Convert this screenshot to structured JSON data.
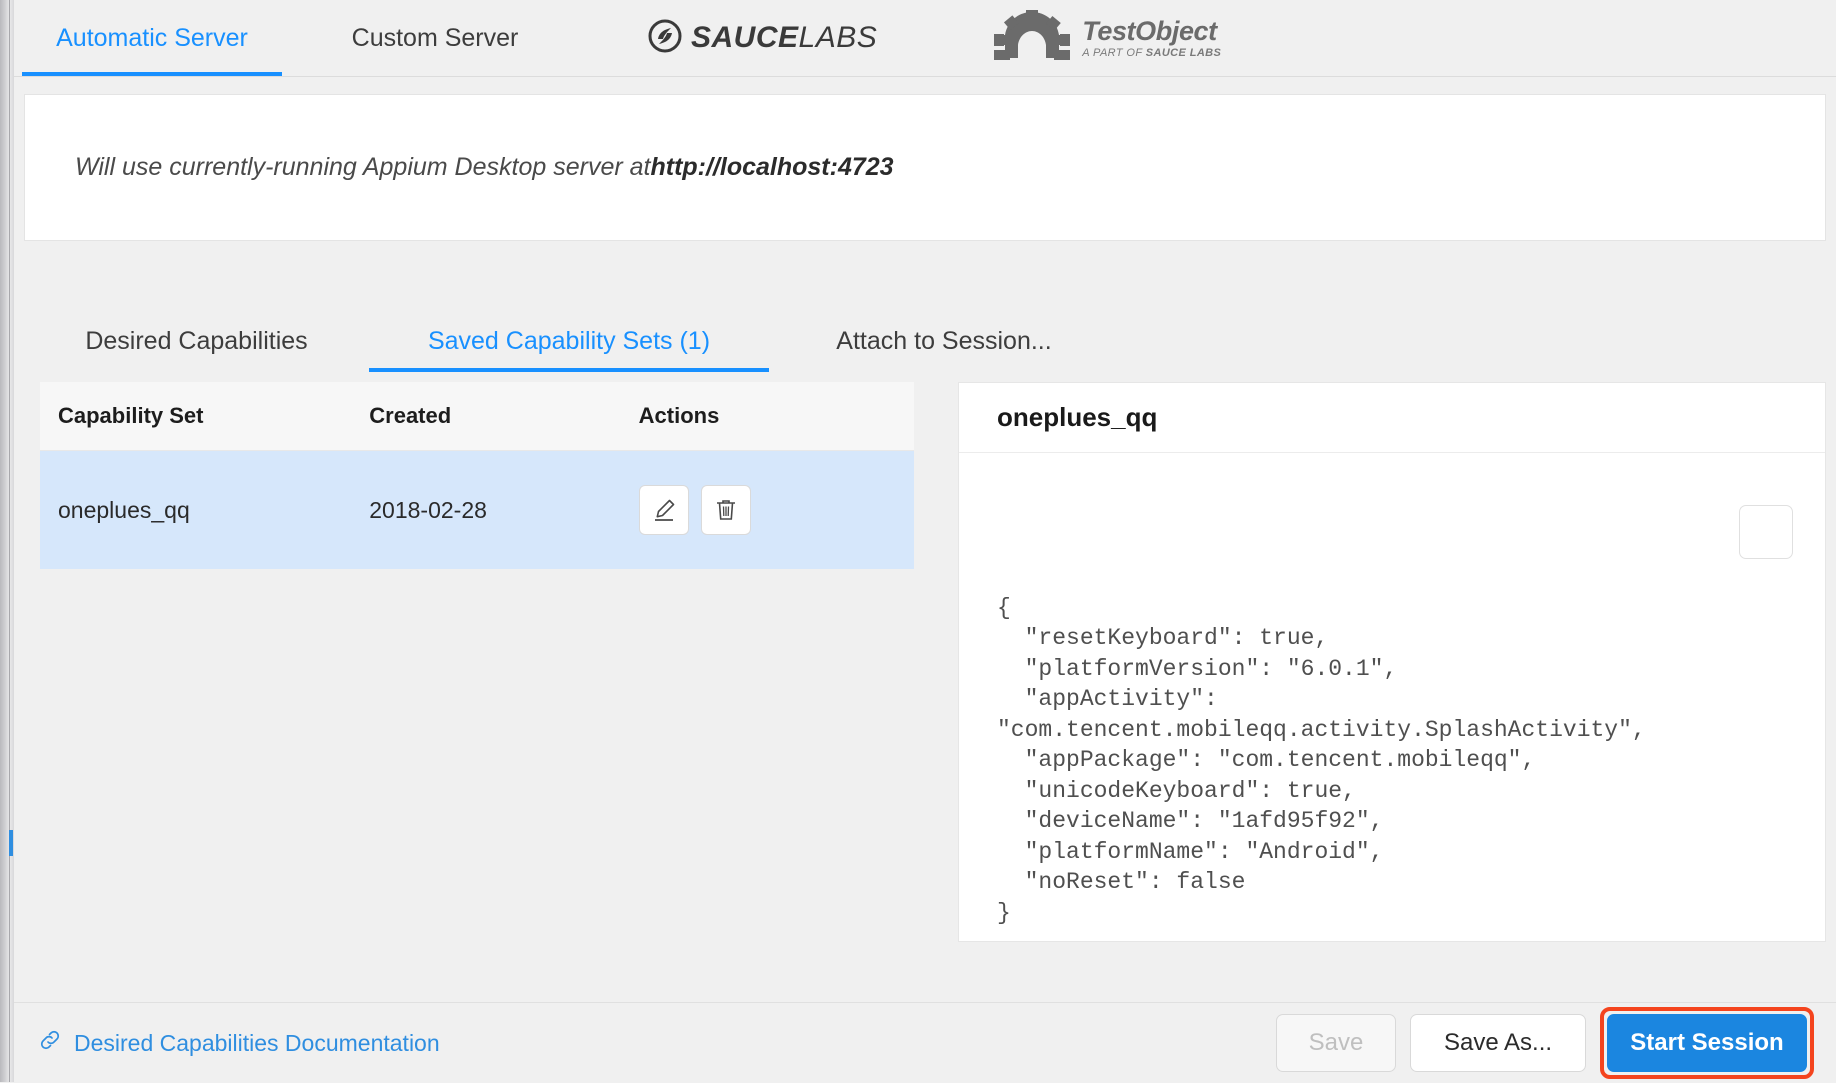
{
  "server_tabs": [
    {
      "id": "automatic",
      "label": "Automatic Server",
      "active": true
    },
    {
      "id": "custom",
      "label": "Custom Server",
      "active": false
    }
  ],
  "brand": {
    "saucelabs_bold": "SAUCE",
    "saucelabs_light": "LABS",
    "testobject_main": "TestObject",
    "testobject_sub_pre": "A PART OF ",
    "testobject_sub_bold": "SAUCE LABS"
  },
  "server_info": {
    "text_prefix": "Will use currently-running Appium Desktop server at ",
    "url": "http://localhost:4723"
  },
  "cap_tabs": [
    {
      "id": "desired",
      "label": "Desired Capabilities",
      "active": false
    },
    {
      "id": "saved",
      "label": "Saved Capability Sets (1)",
      "active": true
    },
    {
      "id": "attach",
      "label": "Attach to Session...",
      "active": false
    }
  ],
  "table": {
    "columns": [
      "Capability Set",
      "Created",
      "Actions"
    ],
    "rows": [
      {
        "name": "oneplues_qq",
        "created": "2018-02-28"
      }
    ]
  },
  "detail": {
    "title": "oneplues_qq",
    "json_text": "{\n  \"resetKeyboard\": true,\n  \"platformVersion\": \"6.0.1\",\n  \"appActivity\":\n\"com.tencent.mobileqq.activity.SplashActivity\",\n  \"appPackage\": \"com.tencent.mobileqq\",\n  \"unicodeKeyboard\": true,\n  \"deviceName\": \"1afd95f92\",\n  \"platformName\": \"Android\",\n  \"noReset\": false\n}"
  },
  "footer": {
    "doc_link": "Desired Capabilities Documentation",
    "save_label": "Save",
    "save_as_label": "Save As...",
    "start_session_label": "Start Session"
  },
  "colors": {
    "accent_blue": "#1890ff",
    "primary_button": "#1b86e0",
    "highlight_red": "#f4441e",
    "row_selected": "#d6e7fb",
    "link_blue": "#2f8ee0"
  }
}
